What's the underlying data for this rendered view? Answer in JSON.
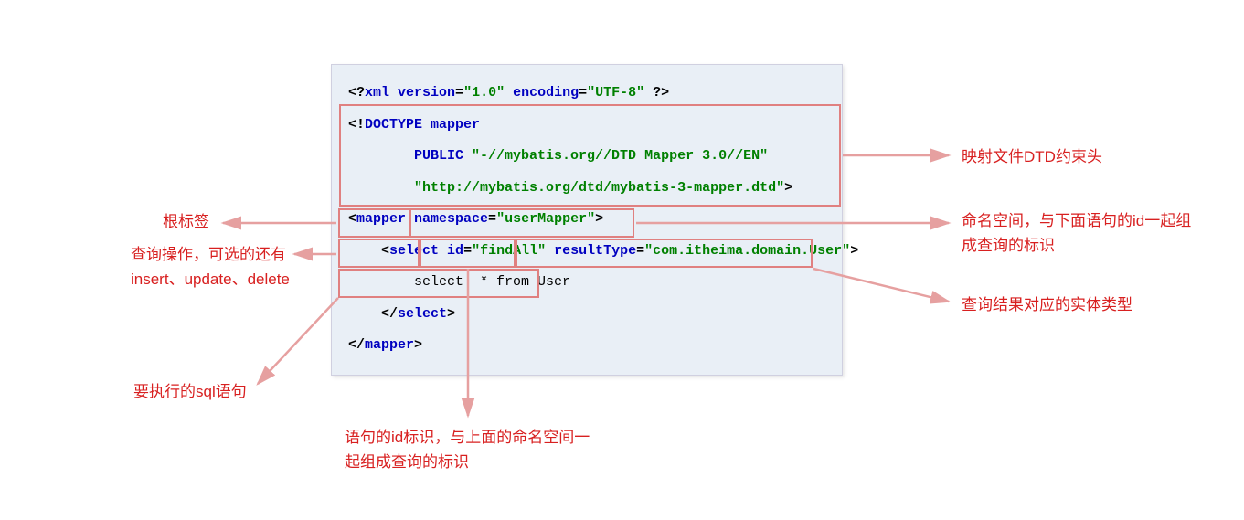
{
  "code": {
    "xml_decl_open": "<?",
    "xml_decl_name": "xml",
    "xml_version_attr": " version",
    "xml_version_eq": "=",
    "xml_version_val": "\"1.0\"",
    "xml_encoding_attr": " encoding",
    "xml_encoding_eq": "=",
    "xml_encoding_val": "\"UTF-8\"",
    "xml_decl_close": " ?>",
    "doctype_open": "<!",
    "doctype_kw": "DOCTYPE",
    "doctype_name": " mapper",
    "doctype_public": "PUBLIC",
    "doctype_fpi": " \"-//mybatis.org//DTD Mapper 3.0//EN\"",
    "doctype_uri": "\"http://mybatis.org/dtd/mybatis-3-mapper.dtd\"",
    "doctype_close": ">",
    "mapper_open_lt": "<",
    "mapper_tag": "mapper",
    "mapper_ns_attr": " namespace",
    "mapper_ns_eq": "=",
    "mapper_ns_val": "\"userMapper\"",
    "mapper_open_gt": ">",
    "select_open_lt": "<",
    "select_tag": "select",
    "select_id_attr": " id",
    "select_id_eq": "=",
    "select_id_val": "\"findAll\"",
    "select_rt_attr": " resultType",
    "select_rt_eq": "=",
    "select_rt_val": "\"com.itheima.domain.User\"",
    "select_open_gt": ">",
    "sql_text": "select  * from User",
    "select_close": "</",
    "select_close_tag": "select",
    "select_close_gt": ">",
    "mapper_close": "</",
    "mapper_close_tag": "mapper",
    "mapper_close_gt": ">"
  },
  "annotations": {
    "dtd_header": "映射文件DTD约束头",
    "root_tag": "根标签",
    "namespace": "命名空间，与下面语句的id一起组成查询的标识",
    "crud": "查询操作，可选的还有insert、update、delete",
    "result_type": "查询结果对应的实体类型",
    "sql": "要执行的sql语句",
    "stmt_id": "语句的id标识，与上面的命名空间一起组成查询的标识"
  }
}
